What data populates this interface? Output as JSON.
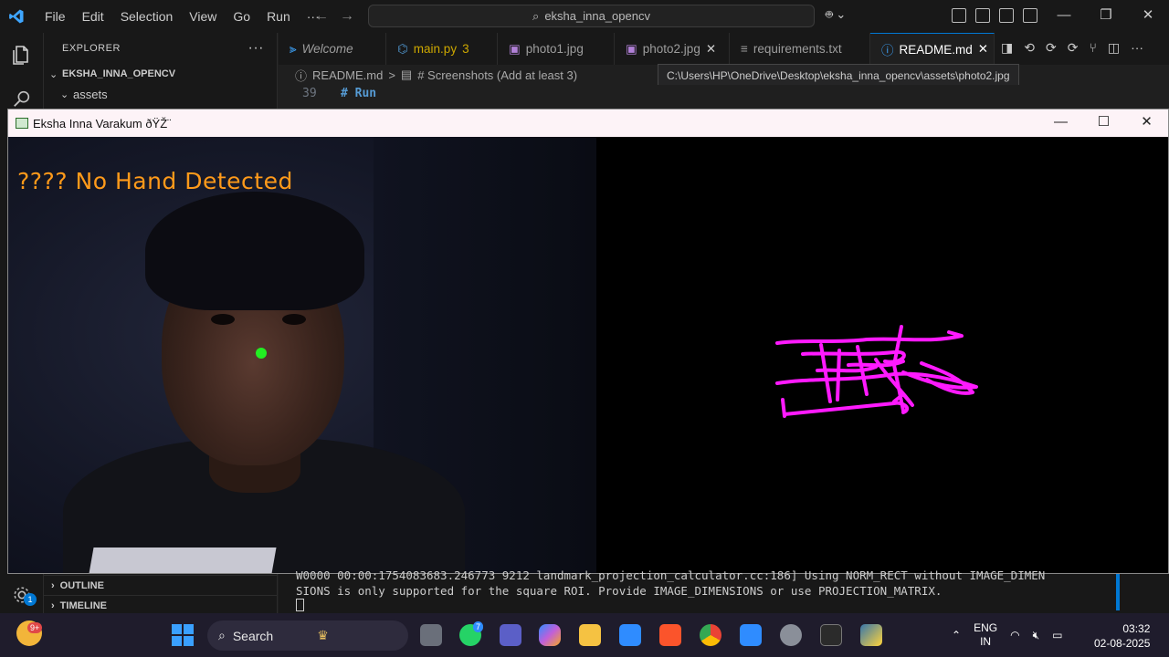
{
  "titlebar": {
    "menu": [
      "File",
      "Edit",
      "Selection",
      "View",
      "Go",
      "Run",
      "···"
    ],
    "command_center": "eksha_inna_opencv"
  },
  "sidebar": {
    "header": "EXPLORER",
    "more": "···",
    "project": "EKSHA_INNA_OPENCV",
    "folder": "assets",
    "outline": "OUTLINE",
    "timeline": "TIMELINE"
  },
  "activity": {
    "settings_badge": "1"
  },
  "tabs": [
    {
      "label": "Welcome",
      "icon": "vscode-icon"
    },
    {
      "label": "main.py",
      "icon": "python-icon",
      "problems": "3"
    },
    {
      "label": "photo1.jpg",
      "icon": "image-icon"
    },
    {
      "label": "photo2.jpg",
      "icon": "image-icon"
    },
    {
      "label": "requirements.txt",
      "icon": "text-file-icon"
    },
    {
      "label": "README.md",
      "icon": "info-icon"
    }
  ],
  "breadcrumb": {
    "file": "README.md",
    "sep": ">",
    "section": "# Screenshots (Add at least 3)"
  },
  "tooltip": "C:\\Users\\HP\\OneDrive\\Desktop\\eksha_inna_opencv\\assets\\photo2.jpg",
  "editor": {
    "line_number": "39",
    "line_text": "# Run"
  },
  "cv_window": {
    "title": "Eksha Inna Varakum ðŸŽ¨",
    "status_text": "???? No Hand Detected",
    "dot_color": "#22ee22",
    "stroke_color": "#ff1aff"
  },
  "terminal": {
    "line1": "W0000 00:00:1754083683.246773    9212 landmark_projection_calculator.cc:186] Using NORM_RECT without IMAGE_DIMEN",
    "line2": "SIONS is only supported for the square ROI. Provide IMAGE_DIMENSIONS or use PROJECTION_MATRIX."
  },
  "taskbar": {
    "weather_badge": "9+",
    "search": "Search",
    "whatsapp_badge": "7",
    "lang_top": "ENG",
    "lang_bottom": "IN",
    "time": "03:32",
    "date": "02-08-2025"
  }
}
